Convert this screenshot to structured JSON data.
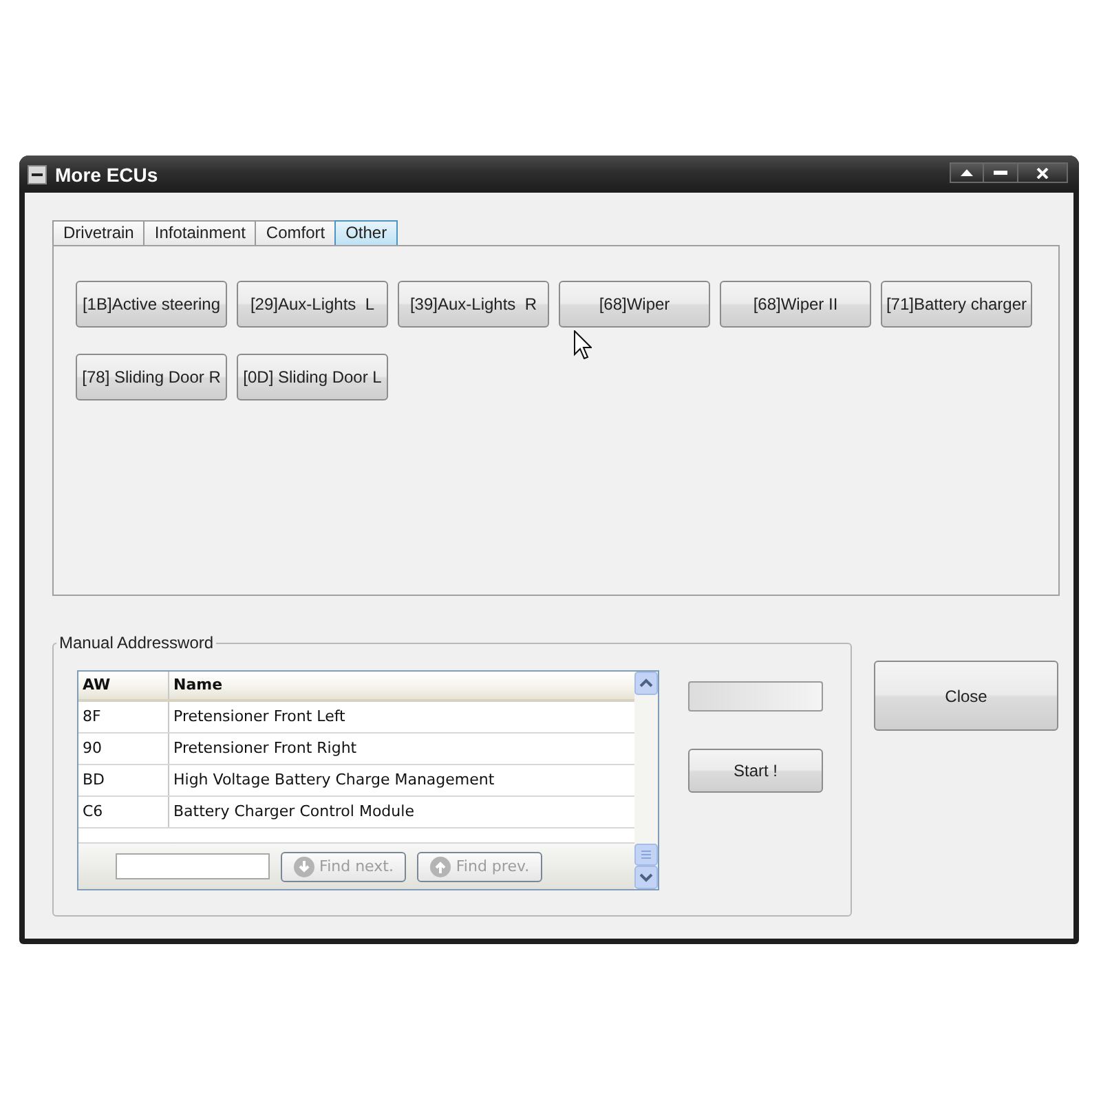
{
  "window": {
    "title": "More ECUs"
  },
  "tabs": [
    {
      "label": "Drivetrain",
      "selected": false
    },
    {
      "label": "Infotainment",
      "selected": false
    },
    {
      "label": "Comfort",
      "selected": false
    },
    {
      "label": "Other",
      "selected": true
    }
  ],
  "ecu_buttons": [
    "[1B]Active steering",
    "[29]Aux-Lights  L",
    "[39]Aux-Lights  R",
    "[68]Wiper",
    "[68]Wiper II",
    "[71]Battery charger",
    "[78] Sliding Door R",
    "[0D] Sliding Door L"
  ],
  "manual_addressword": {
    "title": "Manual Addressword",
    "table": {
      "columns": [
        "AW",
        "Name"
      ],
      "rows": [
        [
          "8F",
          "Pretensioner Front Left"
        ],
        [
          "90",
          "Pretensioner Front Right"
        ],
        [
          "BD",
          "High Voltage Battery Charge Management"
        ],
        [
          "C6",
          "Battery Charger Control Module"
        ]
      ]
    },
    "find_buttons": [
      {
        "kind": "next",
        "label": "Find next.",
        "disabled": true
      },
      {
        "kind": "prev",
        "label": "Find prev.",
        "disabled": true
      }
    ],
    "start_button": "Start !"
  },
  "close_button": "Close"
}
